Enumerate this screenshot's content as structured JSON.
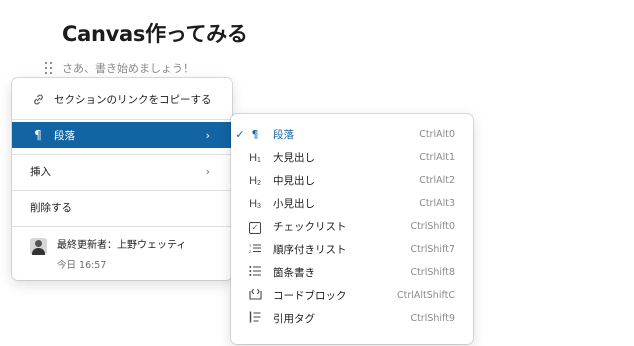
{
  "document": {
    "title": "Canvas作ってみる",
    "placeholder": "さあ、書き始めましょう！"
  },
  "context_menu": {
    "copy_link_label": "セクションのリンクをコピーする",
    "paragraph_label": "段落",
    "insert_label": "挿入",
    "delete_label": "削除する",
    "last_updated_label": "最終更新者：上野ウェッティ",
    "last_updated_time": "今日 16:57"
  },
  "submenu": {
    "items": [
      {
        "label": "段落",
        "shortcut": "CtrlAlt0",
        "icon": "pilcrow-icon",
        "selected": true
      },
      {
        "label": "大見出し",
        "shortcut": "CtrlAlt1",
        "icon": "heading1-icon",
        "selected": false
      },
      {
        "label": "中見出し",
        "shortcut": "CtrlAlt2",
        "icon": "heading2-icon",
        "selected": false
      },
      {
        "label": "小見出し",
        "shortcut": "CtrlAlt3",
        "icon": "heading3-icon",
        "selected": false
      },
      {
        "label": "チェックリスト",
        "shortcut": "CtrlShift0",
        "icon": "checkbox-icon",
        "selected": false
      },
      {
        "label": "順序付きリスト",
        "shortcut": "CtrlShift7",
        "icon": "ordered-list-icon",
        "selected": false
      },
      {
        "label": "箇条書き",
        "shortcut": "CtrlShift8",
        "icon": "bullet-list-icon",
        "selected": false
      },
      {
        "label": "コードブロック",
        "shortcut": "CtrlAltShiftC",
        "icon": "code-block-icon",
        "selected": false
      },
      {
        "label": "引用タグ",
        "shortcut": "CtrlShift9",
        "icon": "quote-icon",
        "selected": false
      }
    ]
  },
  "colors": {
    "accent": "#1264a3",
    "text": "#1d1c1d",
    "muted": "#8a8a8a"
  }
}
